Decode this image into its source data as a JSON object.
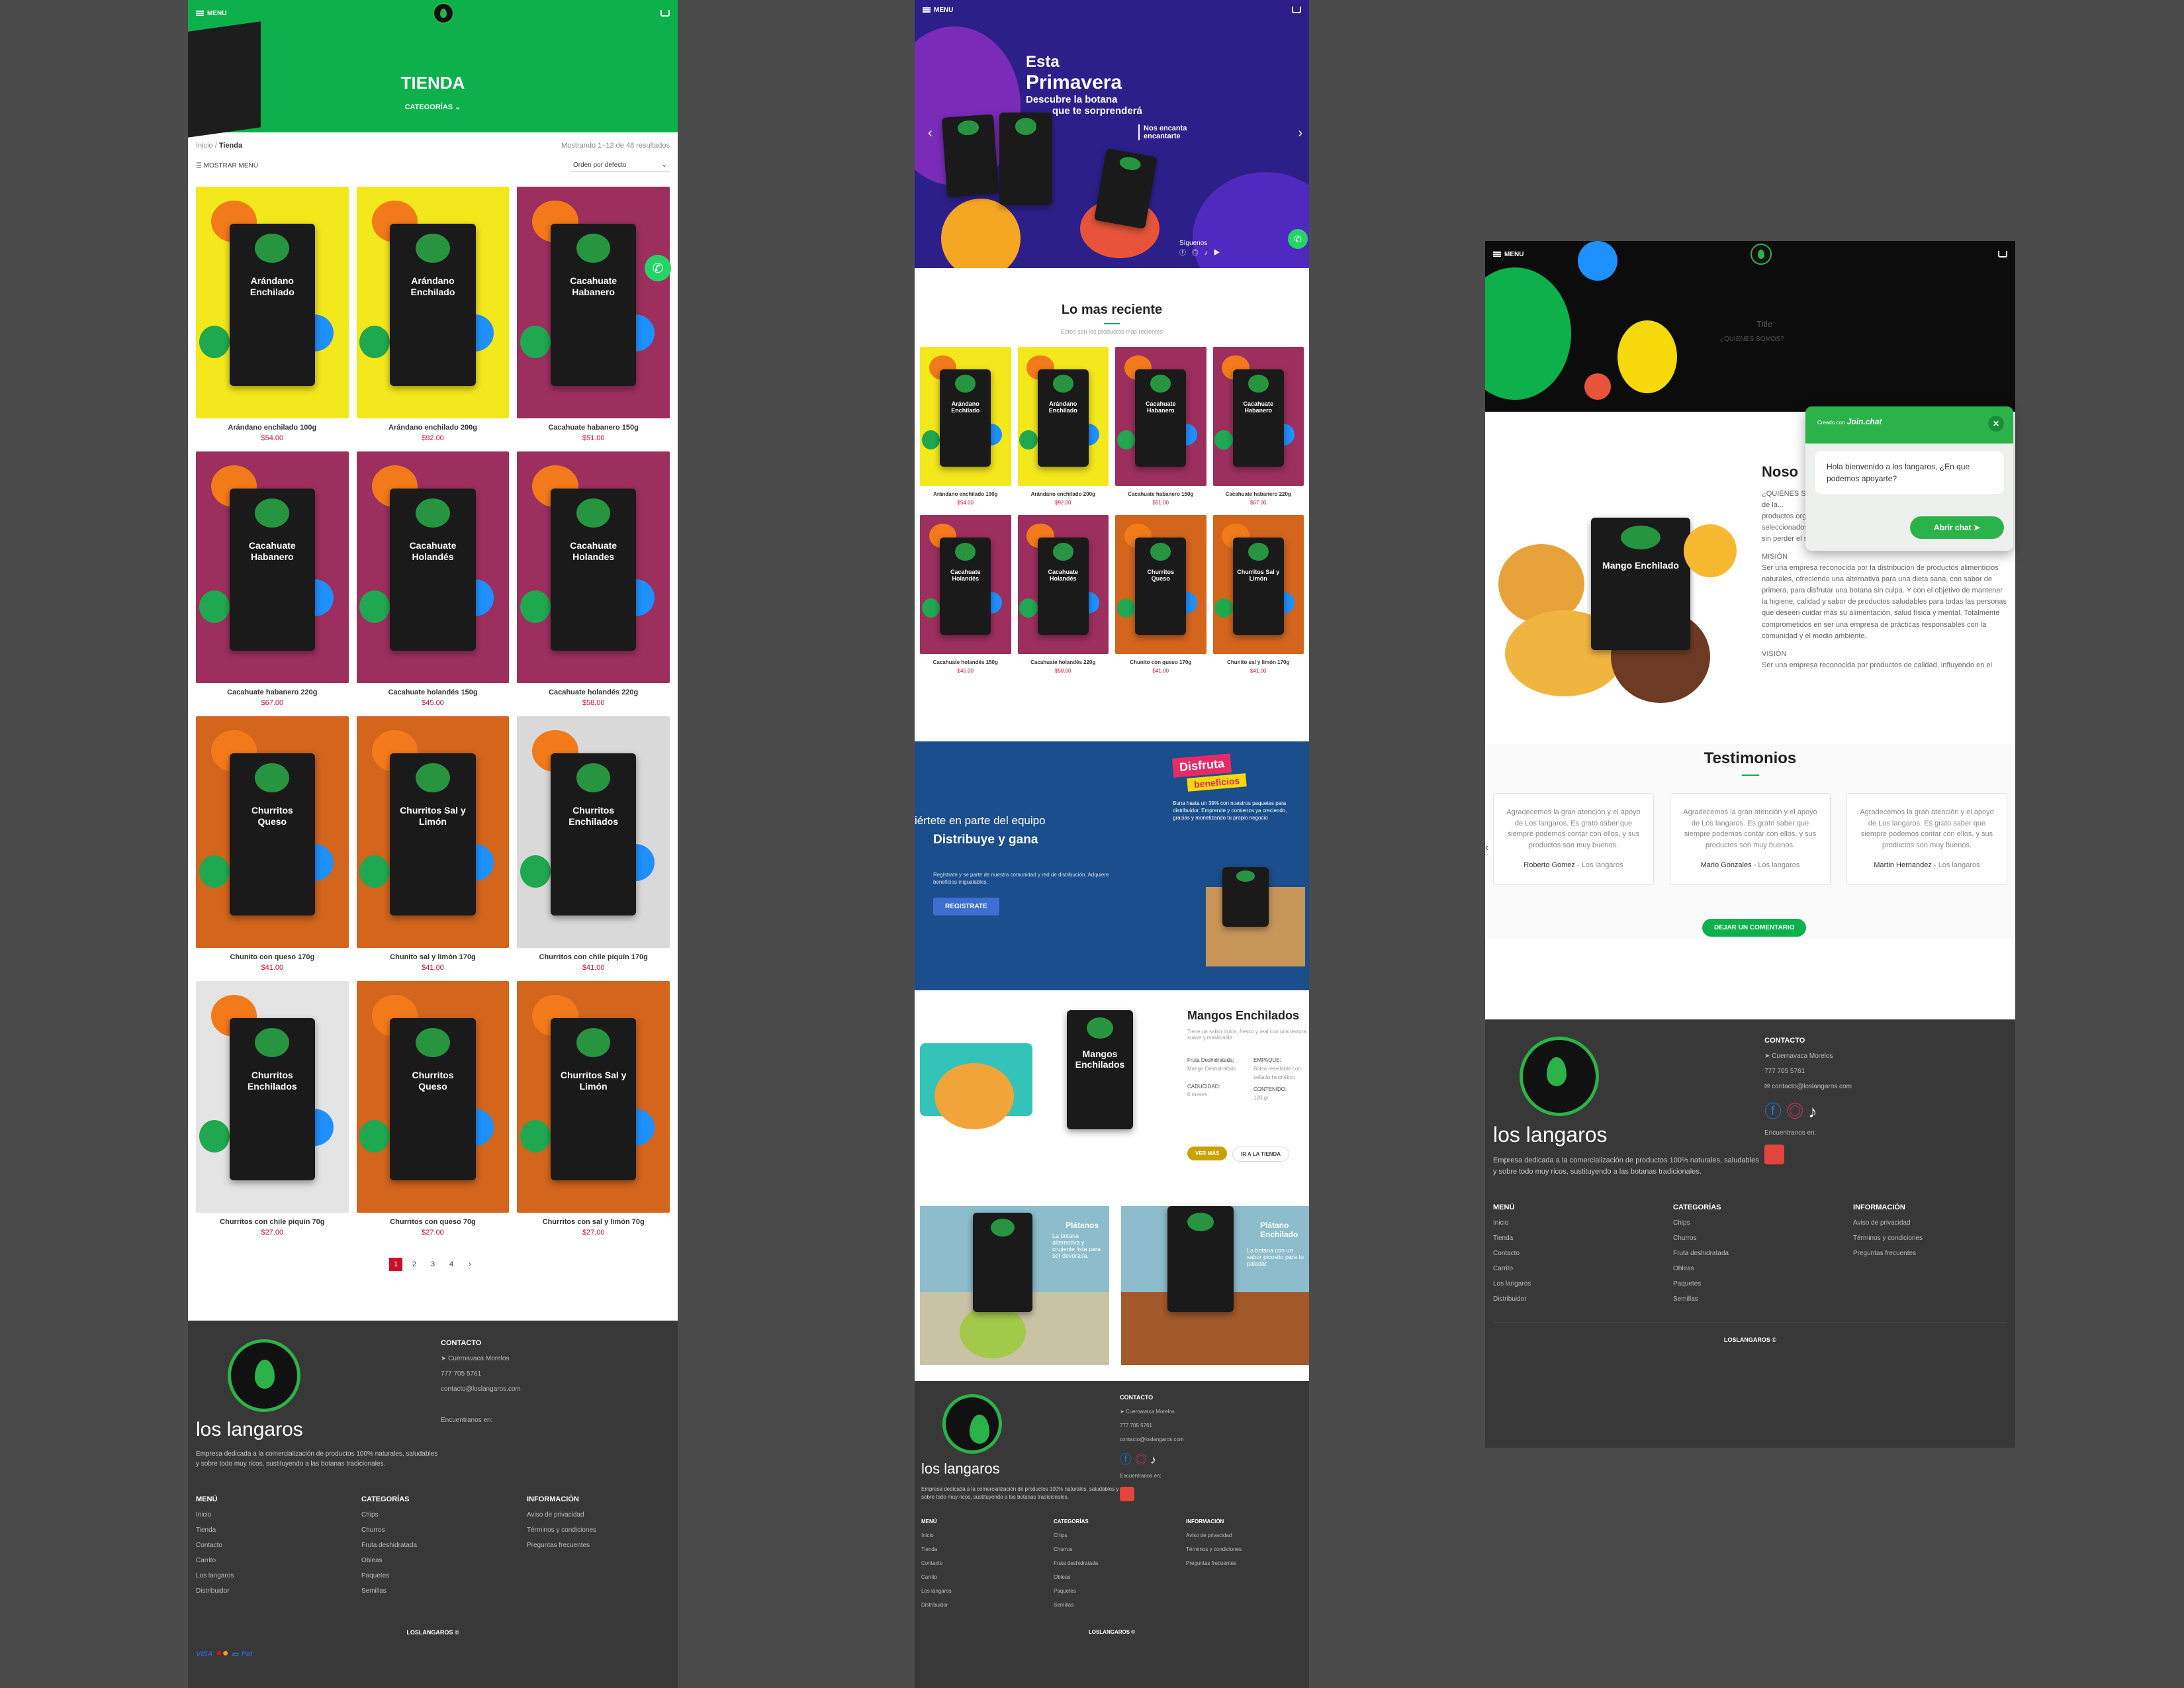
{
  "common": {
    "menu_label": "MENU",
    "brand": "los langaros",
    "brand_desc": "Empresa dedicada a la comercialización de productos 100% naturales, saludables y sobre todo muy ricos, sustituyendo a las botanas tradicionales.",
    "contact_heading": "CONTACTO",
    "location": "Cuernavaca Morelos",
    "phone": "777 705 5761",
    "email": "contacto@loslangaros.com",
    "find_us": "Encuentranos en:",
    "menu_heading": "MENÚ",
    "menu_links": [
      "Inicio",
      "Tienda",
      "Contacto",
      "Carrito",
      "Los langaros",
      "Distribuidor"
    ],
    "categories_heading": "CATEGORÍAS",
    "categories": [
      "Chips",
      "Churros",
      "Fruta deshidratada",
      "Obleas",
      "Paquetes",
      "Semillas"
    ],
    "info_heading": "INFORMACIÓN",
    "info_links": [
      "Aviso de privacidad",
      "Términos y condiciones",
      "Preguntas frecuentes"
    ],
    "copyright": "LOSLANGAROS ©",
    "payments": [
      "VISA",
      "Pal"
    ]
  },
  "shop": {
    "title": "TIENDA",
    "categories_toggle": "CATEGORÍAS",
    "breadcrumb_home": "Inicio",
    "breadcrumb_current": "Tienda",
    "results": "Mostrando 1–12 de 48 resultados",
    "show_menu": "MOSTRAR MENÚ",
    "sort": "Orden por defecto",
    "products": [
      {
        "name": "Arándano enchilado 100g",
        "price": "$54.00",
        "bag": "Arándano Enchilado",
        "bg": "#f3e81b"
      },
      {
        "name": "Arándano enchilado 200g",
        "price": "$92.00",
        "bag": "Arándano Enchilado",
        "bg": "#f3e81b"
      },
      {
        "name": "Cacahuate habanero 150g",
        "price": "$51.00",
        "bag": "Cacahuate Habanero",
        "bg": "#9c2f5e"
      },
      {
        "name": "Cacahuate habanero 220g",
        "price": "$67.00",
        "bag": "Cacahuate Habanero",
        "bg": "#9c2f5e"
      },
      {
        "name": "Cacahuate holandés 150g",
        "price": "$45.00",
        "bag": "Cacahuate Holandés",
        "bg": "#9c2f5e"
      },
      {
        "name": "Cacahuate holandés 220g",
        "price": "$58.00",
        "bag": "Cacahuate Holandes",
        "bg": "#9c2f5e"
      },
      {
        "name": "Chunito con queso 170g",
        "price": "$41.00",
        "bag": "Churritos Queso",
        "bg": "#d3651d"
      },
      {
        "name": "Chunito sal y limón 170g",
        "price": "$41.00",
        "bag": "Churritos Sal y Limón",
        "bg": "#d3651d"
      },
      {
        "name": "Churritos con chile piquín 170g",
        "price": "$41.00",
        "bag": "Churritos Enchilados",
        "bg": "#d9d9d9"
      },
      {
        "name": "Churritos con chile piquín 70g",
        "price": "$27.00",
        "bag": "Churritos Enchilados",
        "bg": "#e4e4e4"
      },
      {
        "name": "Churritos con queso 70g",
        "price": "$27.00",
        "bag": "Churritos Queso",
        "bg": "#d3651d"
      },
      {
        "name": "Churritos con sal y limón 70g",
        "price": "$27.00",
        "bag": "Churritos Sal y Limón",
        "bg": "#d3651d"
      }
    ],
    "pages": [
      "1",
      "2",
      "3",
      "4",
      "›"
    ]
  },
  "home": {
    "hero_line1": "Esta",
    "hero_line2": "Primavera",
    "hero_line3": "Descubre la botana",
    "hero_line4": "que te sorprenderá",
    "hero_tag1": "Nos encanta",
    "hero_tag2": "encantarte",
    "follow": "Síguenos",
    "latest_title": "Lo mas reciente",
    "latest_sub": "Estos son los productos mas recientes",
    "latest": [
      {
        "name": "Arándano enchilado 100g",
        "price": "$54.00",
        "bag": "Arándano Enchilado",
        "bg": "#f3e81b"
      },
      {
        "name": "Arándano enchilado 200g",
        "price": "$92.00",
        "bag": "Arándano Enchilado",
        "bg": "#f3e81b"
      },
      {
        "name": "Cacahuate habanero 150g",
        "price": "$51.00",
        "bag": "Cacahuate Habanero",
        "bg": "#9c2f5e"
      },
      {
        "name": "Cacahuate habanero 220g",
        "price": "$67.00",
        "bag": "Cacahuate Habanero",
        "bg": "#9c2f5e"
      },
      {
        "name": "Cacahuate holandés 150g",
        "price": "$45.00",
        "bag": "Cacahuate Holandés",
        "bg": "#9c2f5e"
      },
      {
        "name": "Cacahuate holandés 220g",
        "price": "$58.00",
        "bag": "Cacahuate Holandés",
        "bg": "#9c2f5e"
      },
      {
        "name": "Chunito con queso 170g",
        "price": "$41.00",
        "bag": "Churritos Queso",
        "bg": "#d3651d"
      },
      {
        "name": "Chunito sal y limón 170g",
        "price": "$41.00",
        "bag": "Churritos Sal y Limón",
        "bg": "#d3651d"
      }
    ],
    "dist_line1": "iértete en parte del equipo",
    "dist_line2": "Distribuye y gana",
    "dist_desc": "Regístrate y se parte de nuestra comunidad y red de distribución. Adquiere beneficios inigualables.",
    "dist_button": "REGISTRATE",
    "dist_badge1": "Disfruta",
    "dist_badge2": "beneficios",
    "dist_benefit": "Buna hasta un 39% con nuestros paquetes para distribuidor. Emprende y comienza ya creciendo, gracias y monetizando tu propio negocio",
    "mango_title": "Mangos Enchilados",
    "mango_desc": "Tiene un sabor dulce, fresco y real con una textura suave y masticable.",
    "mango_k1": "Fruta Deshidratada:",
    "mango_v1": "Mango Deshidratado",
    "mango_k2": "EMPAQUE:",
    "mango_v2": "Bolsa resellable con sellado hermético",
    "mango_k3": "CADUCIDAD:",
    "mango_v3": "6 meses",
    "mango_k4": "CONTENIDO:",
    "mango_v4": "120 gr",
    "mango_btn1": "VER MÁS",
    "mango_btn2": "IR A LA TIENDA",
    "platanos_title1": "Plátanos",
    "platanos_title2": "Natural",
    "platanos_desc": "La botana alternativa y crujiente lista para ser devorada.",
    "platanoe_title1": "Plátano",
    "platanoe_title2": "Enchilado",
    "platanoe_desc": "La botana con un sabor picosito para tu paladar"
  },
  "about": {
    "hero_title": "Title",
    "hero_sub": "¿QUIENES SOMOS?",
    "heading": "Noso",
    "p1": "¿QUIÉNES SOMOS? PROPÓSITO: Los Langaros... consumo de... Dentro de la...",
    "p2": "productos orgánicos, saludables y 100% naturales estrictamente seleccionados para ayudarte a tener una vida sana, disfrutando sin culpas y sin perder el sabor.",
    "vision_head": "MISIÓN",
    "p3": "Ser una empresa reconocida por la distribución de productos alimenticios naturales, ofreciendo una alternativa para una dieta sana, con sabor de primera, para disfrutar una botana sin culpa. Y con el objetivo de mantener la higiene, calidad y sabor de productos saludables para todas las personas que deseen cuidar más su alimentación, salud física y mental. Totalmente comprometidos en ser una empresa de prácticas responsables con la comunidad y el medio ambiente.",
    "vision2_head": "VISIÓN",
    "p4": "Ser una empresa reconocida por productos de calidad, influyendo en el mundo con botanas y refrigerios saludables, para que la",
    "testimonials_title": "Testimonios",
    "testimonials": [
      {
        "text": "Agradecemos la gran atención y el apoyo de Los langaros. Es grato saber que siempre podemos contar con ellos, y sus productos son muy buenos.",
        "author": "Roberto Gomez",
        "org": "- Los langaros"
      },
      {
        "text": "Agradecemos la gran atención y el apoyo de Los langaros. Es grato saber que siempre podemos contar con ellos, y sus productos son muy buenos.",
        "author": "Mario Gonzales",
        "org": "- Los langaros"
      },
      {
        "text": "Agradecemos la gran atención y el apoyo de Los langaros. Es grato saber que siempre podemos contar con ellos, y sus productos son muy buenos.",
        "author": "Martin Hernandez",
        "org": "- Los langaros"
      }
    ],
    "comment_button": "DEJAR UN COMENTARIO",
    "bag_label": "Mango Enchilado",
    "chat_created": "Creado con",
    "chat_brand": "Join.chat",
    "chat_message": "Hola bienvenido a los langaros, ¿En que podemos apoyarte?",
    "chat_button": "Abrir chat"
  }
}
